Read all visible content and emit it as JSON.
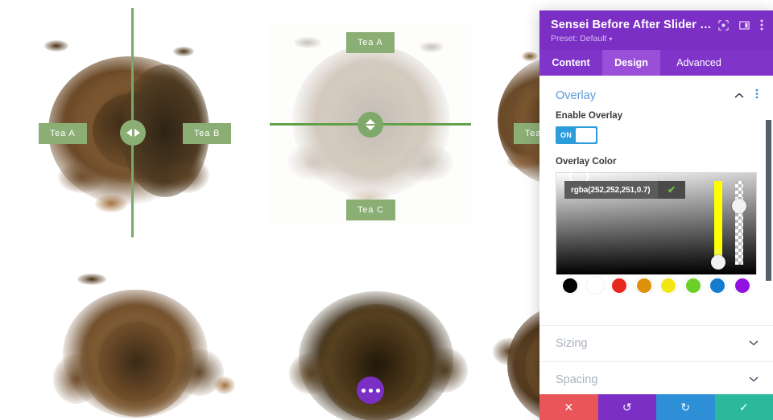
{
  "canvas": {
    "sliders": [
      {
        "name": "slider-vertical",
        "orientation": "vertical",
        "label_a": "Tea A",
        "label_b": "Tea B",
        "handle_icon": "left-right-arrows-icon",
        "overlay_applied": false
      },
      {
        "name": "slider-horizontal",
        "orientation": "horizontal",
        "label_a": "Tea A",
        "label_b": "Tea C",
        "handle_icon": "up-down-arrows-icon",
        "overlay_applied": true
      },
      {
        "name": "slider-partial-right",
        "orientation": "vertical",
        "label_a": "Tea",
        "label_b": "",
        "handle_icon": "left-right-arrows-icon",
        "overlay_applied": false
      }
    ],
    "fab": {
      "icon": "ellipsis-icon",
      "color": "#7b2fc4"
    },
    "divider_color": "#8bae75",
    "label_color": "#8bae75"
  },
  "panel": {
    "title": "Sensei Before After Slider Set...",
    "preset_label": "Preset: Default",
    "preset_caret": "▾",
    "header_icons": [
      {
        "name": "focus-target-icon"
      },
      {
        "name": "layout-columns-icon"
      },
      {
        "name": "more-vertical-icon"
      }
    ],
    "header_color": "#7b2fc4",
    "tabs": [
      {
        "label": "Content",
        "active": false
      },
      {
        "label": "Design",
        "active": true
      },
      {
        "label": "Advanced",
        "active": false
      }
    ],
    "overlay_section": {
      "title": "Overlay",
      "collapse_icon": "chevron-up-icon",
      "menu_icon": "more-vertical-icon",
      "enable_overlay": {
        "label": "Enable Overlay",
        "state": "ON",
        "on": true
      },
      "overlay_color": {
        "label": "Overlay Color",
        "value": "rgba(252,252,251,0.7)",
        "confirm_icon": "check-icon",
        "hue_slider_value": 60,
        "alpha_slider_value": 0.7,
        "swatches": [
          "#000000",
          "#ffffff",
          "#e8271f",
          "#dd9108",
          "#f2e712",
          "#6cd029",
          "#147bcd",
          "#9012e0"
        ]
      }
    },
    "accordions": [
      {
        "label": "Sizing",
        "icon": "chevron-down-icon"
      },
      {
        "label": "Spacing",
        "icon": "chevron-down-icon"
      }
    ],
    "footer_buttons": [
      {
        "name": "close-button",
        "icon": "close-icon",
        "glyph": "✕",
        "color": "#e8565a"
      },
      {
        "name": "undo-button",
        "icon": "undo-icon",
        "glyph": "↺",
        "color": "#7b2fc4"
      },
      {
        "name": "redo-button",
        "icon": "redo-icon",
        "glyph": "↻",
        "color": "#2d8fd5"
      },
      {
        "name": "save-button",
        "icon": "check-icon",
        "glyph": "✓",
        "color": "#2bb99b"
      }
    ]
  }
}
